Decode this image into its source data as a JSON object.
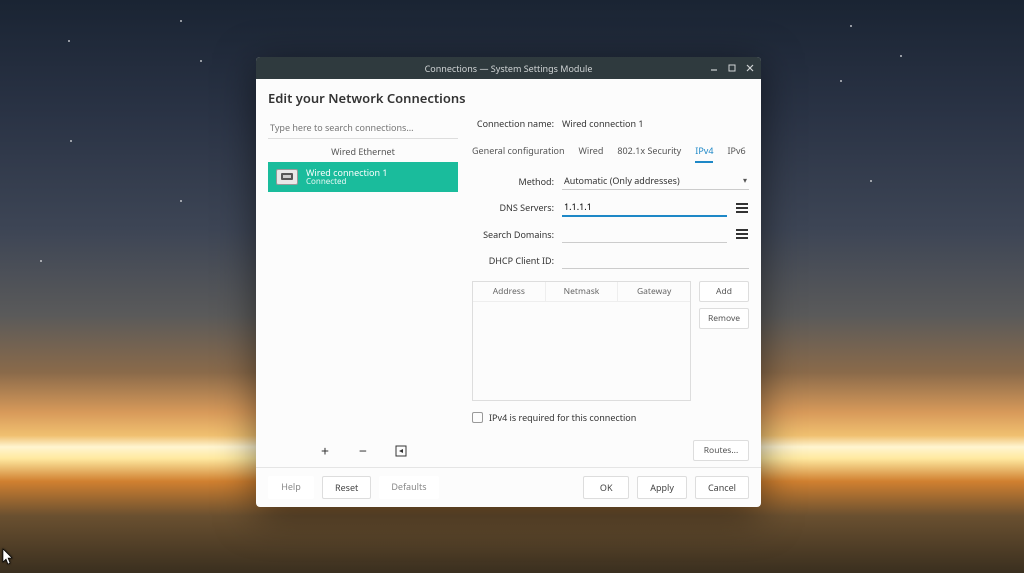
{
  "window": {
    "title": "Connections — System Settings Module"
  },
  "page": {
    "heading": "Edit your Network Connections"
  },
  "sidebar": {
    "search_placeholder": "Type here to search connections...",
    "category": "Wired Ethernet",
    "items": [
      {
        "name": "Wired connection 1",
        "status": "Connected"
      }
    ]
  },
  "connection": {
    "name_label": "Connection name:",
    "name_value": "Wired connection 1"
  },
  "tabs": [
    {
      "label": "General configuration"
    },
    {
      "label": "Wired"
    },
    {
      "label": "802.1x Security"
    },
    {
      "label": "IPv4",
      "active": true
    },
    {
      "label": "IPv6"
    }
  ],
  "ipv4": {
    "method_label": "Method:",
    "method_value": "Automatic (Only addresses)",
    "dns_label": "DNS Servers:",
    "dns_value": "1.1.1.1",
    "search_label": "Search Domains:",
    "search_value": "",
    "dhcp_label": "DHCP Client ID:",
    "dhcp_value": "",
    "table": {
      "col_address": "Address",
      "col_netmask": "Netmask",
      "col_gateway": "Gateway"
    },
    "add_label": "Add",
    "remove_label": "Remove",
    "required_label": "IPv4 is required for this connection",
    "routes_label": "Routes..."
  },
  "footer": {
    "help": "Help",
    "reset": "Reset",
    "defaults": "Defaults",
    "ok": "OK",
    "apply": "Apply",
    "cancel": "Cancel"
  }
}
